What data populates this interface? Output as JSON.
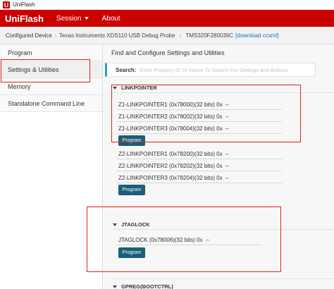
{
  "window": {
    "title": "UniFlash"
  },
  "header": {
    "brand": "UniFlash",
    "menu": [
      {
        "label": "Session"
      },
      {
        "label": "About"
      }
    ]
  },
  "device_bar": {
    "label": "Configured Device",
    "separator": ":",
    "device": "Texas Instruments XDS110 USB Debug Probe",
    "cpu": "TMS320F280039C",
    "link": "[download ccxml]"
  },
  "sidebar": {
    "items": [
      {
        "label": "Program"
      },
      {
        "label": "Settings & Utilities"
      },
      {
        "label": "Memory"
      },
      {
        "label": "Standalone Command Line"
      }
    ]
  },
  "main": {
    "title": "Find and Configure Settings and Utilities",
    "search": {
      "label": "Search:",
      "placeholder": "Enter Property ID Or Name To Search For Settings and Buttons"
    },
    "linkpointer": {
      "title": "LINKPOINTER",
      "z1_rows": [
        {
          "label": "Z1-LINKPOINTER1 (0x78000)(32 bits) 0x",
          "value": "--"
        },
        {
          "label": "Z1-LINKPOINTER2 (0x78002)(32 bits) 0x",
          "value": "--"
        },
        {
          "label": "Z1-LINKPOINTER3 (0x78004)(32 bits) 0x",
          "value": "--"
        }
      ],
      "z1_button": "Program",
      "z2_rows": [
        {
          "label": "Z2-LINKPOINTER1 (0x78200)(32 bits) 0x",
          "value": "--"
        },
        {
          "label": "Z2-LINKPOINTER2 (0x78202)(32 bits) 0x",
          "value": "--"
        },
        {
          "label": "Z2-LINKPOINTER3 (0x78204)(32 bits) 0x",
          "value": "--"
        }
      ],
      "z2_button": "Program"
    },
    "jtaglock": {
      "title": "JTAGLOCK",
      "rows": [
        {
          "label": "JTAGLOCK (0x78006)(32 bits) 0x",
          "value": "--"
        }
      ],
      "button": "Program"
    },
    "gpreg": {
      "title": "GPREG(BOOTCTRL)"
    }
  },
  "colors": {
    "brand_red": "#cc0000",
    "button": "#1a5e79",
    "annotation": "#e0201f",
    "search_accent": "#2e9fc2"
  }
}
